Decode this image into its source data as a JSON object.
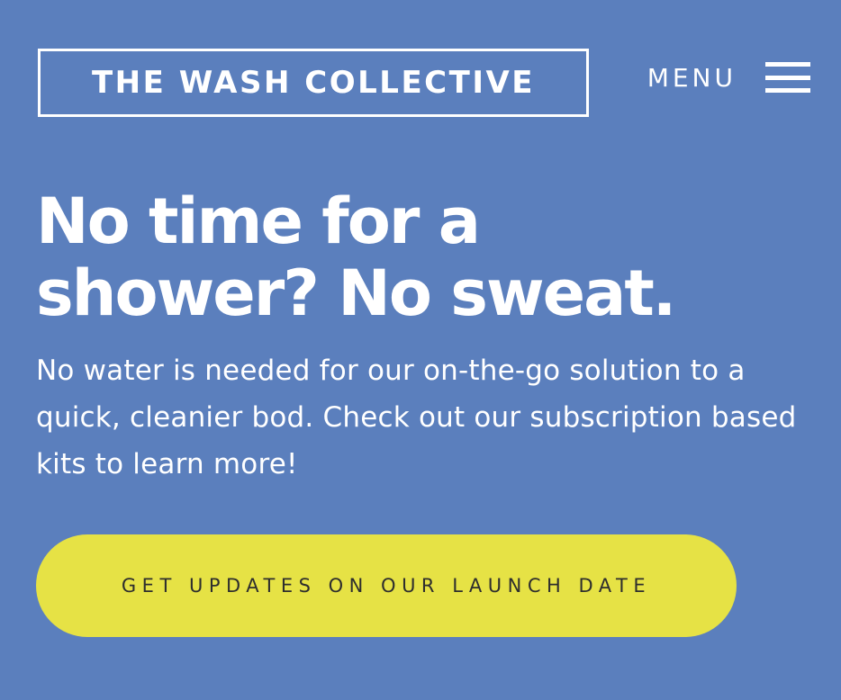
{
  "header": {
    "logo_text": "THE WASH COLLECTIVE",
    "menu_label": "MENU",
    "menu_icon": "hamburger-icon"
  },
  "hero": {
    "headline_line1": "No time for a",
    "headline_line2": "shower? No sweat.",
    "description": "No water is needed for our on-the-go solution to a quick, cleanier bod. Check out our subscription based kits to learn more!",
    "cta_label": "GET UPDATES ON OUR LAUNCH DATE"
  },
  "colors": {
    "background": "#5b7fbd",
    "text": "#ffffff",
    "cta_background": "#e6e245",
    "cta_text": "#2e2e2e"
  }
}
